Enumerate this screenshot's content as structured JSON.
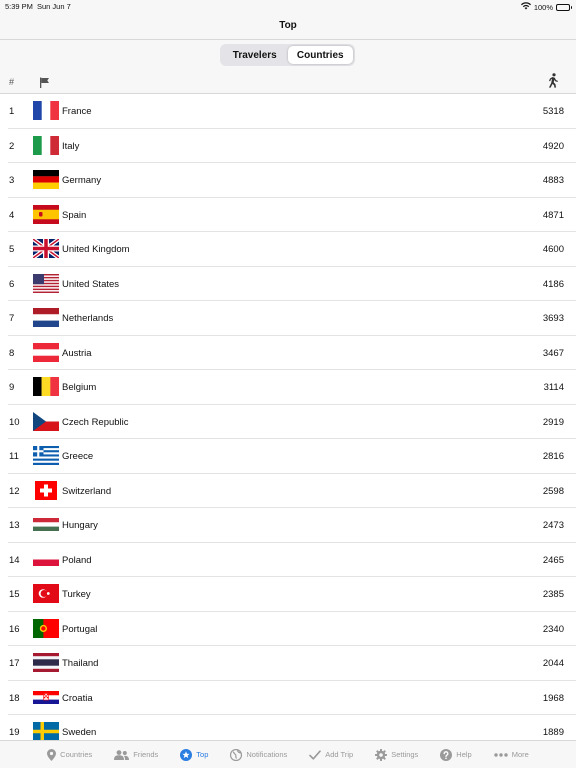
{
  "status": {
    "time": "5:39 PM",
    "date": "Sun Jun 7",
    "battery": "100%"
  },
  "nav": {
    "title": "Top"
  },
  "segments": [
    {
      "label": "Travelers",
      "active": false
    },
    {
      "label": "Countries",
      "active": true
    }
  ],
  "columns": {
    "rank": "#",
    "flag_icon": "flag-icon",
    "visits_icon": "walking-person-icon"
  },
  "rows": [
    {
      "rank": "1",
      "country": "France",
      "count": "5318",
      "flag": "france"
    },
    {
      "rank": "2",
      "country": "Italy",
      "count": "4920",
      "flag": "italy"
    },
    {
      "rank": "3",
      "country": "Germany",
      "count": "4883",
      "flag": "germany"
    },
    {
      "rank": "4",
      "country": "Spain",
      "count": "4871",
      "flag": "spain"
    },
    {
      "rank": "5",
      "country": "United Kingdom",
      "count": "4600",
      "flag": "uk"
    },
    {
      "rank": "6",
      "country": "United States",
      "count": "4186",
      "flag": "usa"
    },
    {
      "rank": "7",
      "country": "Netherlands",
      "count": "3693",
      "flag": "netherlands"
    },
    {
      "rank": "8",
      "country": "Austria",
      "count": "3467",
      "flag": "austria"
    },
    {
      "rank": "9",
      "country": "Belgium",
      "count": "3114",
      "flag": "belgium"
    },
    {
      "rank": "10",
      "country": "Czech Republic",
      "count": "2919",
      "flag": "czech"
    },
    {
      "rank": "11",
      "country": "Greece",
      "count": "2816",
      "flag": "greece"
    },
    {
      "rank": "12",
      "country": "Switzerland",
      "count": "2598",
      "flag": "switzerland"
    },
    {
      "rank": "13",
      "country": "Hungary",
      "count": "2473",
      "flag": "hungary"
    },
    {
      "rank": "14",
      "country": "Poland",
      "count": "2465",
      "flag": "poland"
    },
    {
      "rank": "15",
      "country": "Turkey",
      "count": "2385",
      "flag": "turkey"
    },
    {
      "rank": "16",
      "country": "Portugal",
      "count": "2340",
      "flag": "portugal"
    },
    {
      "rank": "17",
      "country": "Thailand",
      "count": "2044",
      "flag": "thailand"
    },
    {
      "rank": "18",
      "country": "Croatia",
      "count": "1968",
      "flag": "croatia"
    },
    {
      "rank": "19",
      "country": "Sweden",
      "count": "1889",
      "flag": "sweden"
    }
  ],
  "tabs": [
    {
      "label": "Countries",
      "icon": "map-pin-icon",
      "active": false
    },
    {
      "label": "Friends",
      "icon": "friends-icon",
      "active": false
    },
    {
      "label": "Top",
      "icon": "star-icon",
      "active": true
    },
    {
      "label": "Notifications",
      "icon": "globe-icon",
      "active": false
    },
    {
      "label": "Add Trip",
      "icon": "checkmark-icon",
      "active": false
    },
    {
      "label": "Settings",
      "icon": "gear-icon",
      "active": false
    },
    {
      "label": "Help",
      "icon": "question-icon",
      "active": false
    },
    {
      "label": "More",
      "icon": "ellipsis-icon",
      "active": false
    }
  ],
  "colors": {
    "accent": "#2a7de1",
    "inactive": "#9a9a9a",
    "background": "#f7f7f7"
  }
}
